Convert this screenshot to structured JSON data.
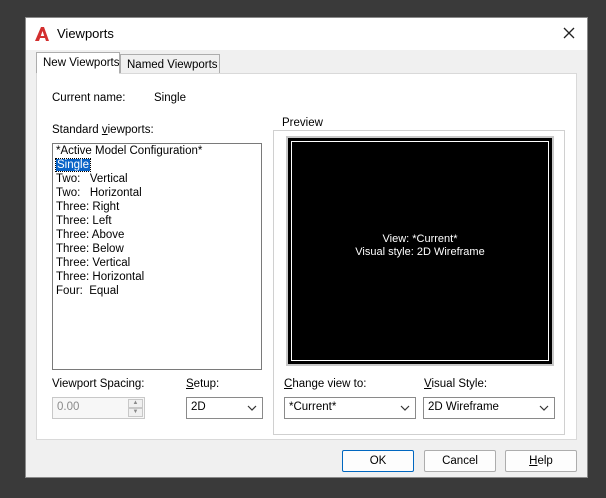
{
  "window": {
    "title": "Viewports"
  },
  "tabs": [
    {
      "label": "New Viewports",
      "active": true
    },
    {
      "label": "Named Viewports",
      "active": false
    }
  ],
  "current_name": {
    "label": "Current name:",
    "value": "Single"
  },
  "standard_viewports": {
    "label": "Standard viewports:",
    "items": [
      "*Active Model Configuration*",
      "Single",
      "Two:   Vertical",
      "Two:   Horizontal",
      "Three: Right",
      "Three: Left",
      "Three: Above",
      "Three: Below",
      "Three: Vertical",
      "Three: Horizontal",
      "Four:  Equal"
    ],
    "selected_index": 1
  },
  "preview": {
    "label": "Preview",
    "line1": "View: *Current*",
    "line2": "Visual style: 2D Wireframe",
    "background": "#000000"
  },
  "viewport_spacing": {
    "label": "Viewport Spacing:",
    "value": "0.00"
  },
  "setup": {
    "label": "Setup:",
    "value": "2D"
  },
  "change_view_to": {
    "label": "Change view to:",
    "value": "*Current*"
  },
  "visual_style": {
    "label": "Visual Style:",
    "value": "2D Wireframe"
  },
  "buttons": {
    "ok": "OK",
    "cancel": "Cancel",
    "help": "Help"
  },
  "colors": {
    "selection": "#0a64c8",
    "app_logo": "#d32f2f",
    "default_button_border": "#0067c0"
  }
}
